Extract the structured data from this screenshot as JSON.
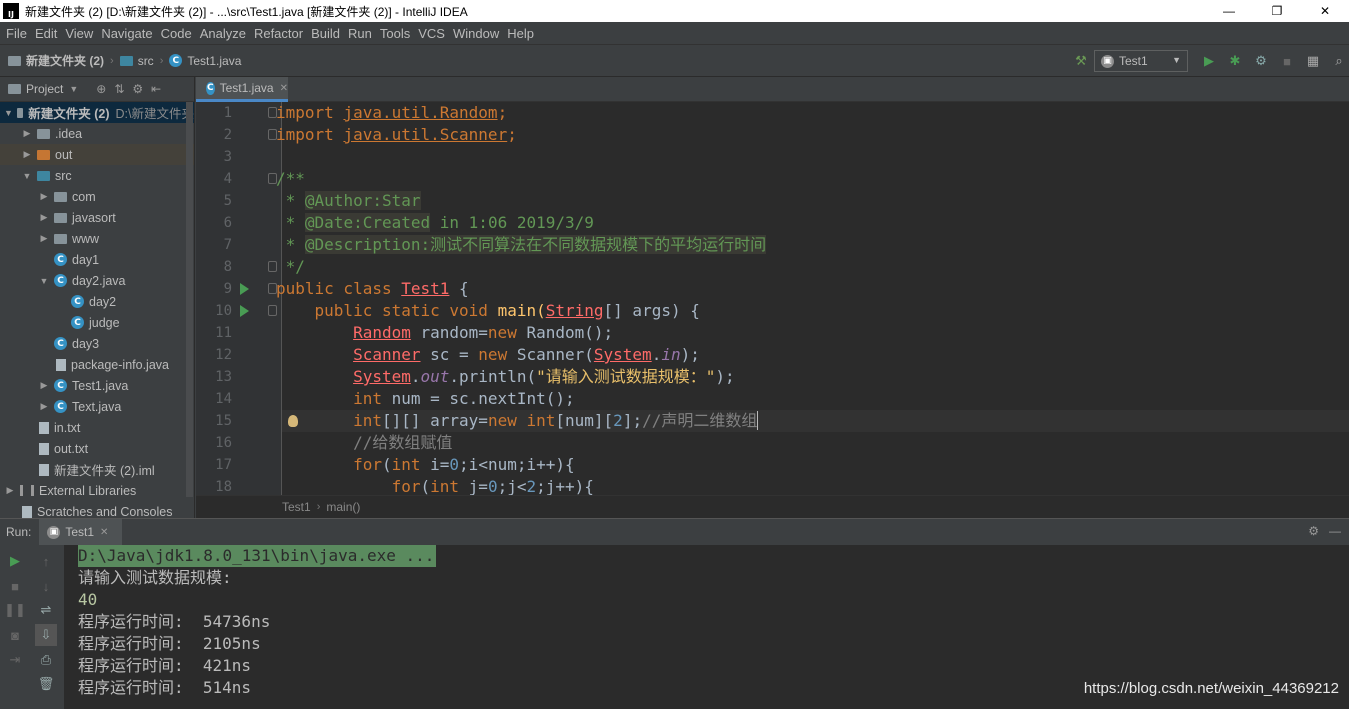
{
  "window": {
    "title": "新建文件夹 (2) [D:\\新建文件夹 (2)] - ...\\src\\Test1.java [新建文件夹 (2)] - IntelliJ IDEA",
    "logo_text": "IJ",
    "controls": [
      "—",
      "❐",
      "✕"
    ]
  },
  "menu": [
    "File",
    "Edit",
    "View",
    "Navigate",
    "Code",
    "Analyze",
    "Refactor",
    "Build",
    "Run",
    "Tools",
    "VCS",
    "Window",
    "Help"
  ],
  "navbar": {
    "project": "新建文件夹 (2)",
    "src": "src",
    "file": "Test1.java",
    "run_config": "Test1"
  },
  "project_panel": {
    "title": "Project",
    "tree": [
      {
        "label": "新建文件夹 (2)",
        "extra": "D:\\新建文件夹",
        "icon": "folder",
        "caret": "▼",
        "depth": 0
      },
      {
        "label": ".idea",
        "icon": "folder",
        "caret": "▶",
        "depth": 1
      },
      {
        "label": "out",
        "icon": "folder-orange",
        "caret": "▶",
        "depth": 1
      },
      {
        "label": "src",
        "icon": "folder-blue",
        "caret": "▼",
        "depth": 1
      },
      {
        "label": "com",
        "icon": "package",
        "caret": "▶",
        "depth": 2
      },
      {
        "label": "javasort",
        "icon": "package",
        "caret": "▶",
        "depth": 2
      },
      {
        "label": "www",
        "icon": "package",
        "caret": "▶",
        "depth": 2
      },
      {
        "label": "day1",
        "icon": "class",
        "caret": "",
        "depth": 2
      },
      {
        "label": "day2.java",
        "icon": "class",
        "caret": "▼",
        "depth": 2
      },
      {
        "label": "day2",
        "icon": "class",
        "caret": "",
        "depth": 3
      },
      {
        "label": "judge",
        "icon": "class",
        "caret": "",
        "depth": 3
      },
      {
        "label": "day3",
        "icon": "class",
        "caret": "",
        "depth": 2
      },
      {
        "label": "package-info.java",
        "icon": "file",
        "caret": "",
        "depth": 2
      },
      {
        "label": "Test1.java",
        "icon": "class",
        "caret": "▶",
        "depth": 2
      },
      {
        "label": "Text.java",
        "icon": "class",
        "caret": "▶",
        "depth": 2
      },
      {
        "label": "in.txt",
        "icon": "file",
        "caret": "",
        "depth": 1
      },
      {
        "label": "out.txt",
        "icon": "file",
        "caret": "",
        "depth": 1
      },
      {
        "label": "新建文件夹 (2).iml",
        "icon": "file",
        "caret": "",
        "depth": 1
      },
      {
        "label": "External Libraries",
        "icon": "library",
        "caret": "▶",
        "depth": 0
      },
      {
        "label": "Scratches and Consoles",
        "icon": "file",
        "caret": "",
        "depth": 0
      }
    ]
  },
  "editor": {
    "tab": "Test1.java",
    "line_numbers": [
      "1",
      "2",
      "3",
      "4",
      "5",
      "6",
      "7",
      "8",
      "9",
      "10",
      "11",
      "12",
      "13",
      "14",
      "15",
      "16",
      "17",
      "18"
    ],
    "breadcrumb": [
      "Test1",
      "main()"
    ]
  },
  "code": {
    "l1": [
      "import ",
      "java.util.Random",
      ";"
    ],
    "l2": [
      "import ",
      "java.util.Scanner",
      ";"
    ],
    "l4": "/**",
    "l5": [
      " * ",
      "@Author:Star"
    ],
    "l6": [
      " * ",
      "@Date:Created",
      " in 1:06 2019/3/9"
    ],
    "l7": [
      " * ",
      "@Description:测试不同算法在不同数据规模下的平均运行时间"
    ],
    "l8": " */",
    "l9": [
      "public class ",
      "Test1",
      " {"
    ],
    "l10": [
      "    public static void ",
      "main(",
      "String",
      "[] args) {"
    ],
    "l11": [
      "        ",
      "Random",
      " random=",
      "new ",
      "Random();"
    ],
    "l12": [
      "        ",
      "Scanner",
      " sc = ",
      "new ",
      "Scanner(",
      "System",
      ".",
      "in",
      ");"
    ],
    "l13": [
      "        ",
      "System",
      ".",
      "out",
      ".println(",
      "\"请输入测试数据规模：\"",
      ");"
    ],
    "l14": [
      "        ",
      "int ",
      "num = sc.nextInt();"
    ],
    "l15": [
      "        ",
      "int",
      "[][] array=",
      "new ",
      "int",
      "[num][",
      "2",
      "];",
      "//声明二维数组"
    ],
    "l16": [
      "        ",
      "//给数组赋值"
    ],
    "l17": [
      "        ",
      "for",
      "(",
      "int ",
      "i=",
      "0",
      ";i<num;i++){"
    ],
    "l18": [
      "            ",
      "for",
      "(",
      "int ",
      "j=",
      "0",
      ";j<",
      "2",
      ";j++){"
    ]
  },
  "run": {
    "label": "Run:",
    "tab": "Test1",
    "console": [
      "D:\\Java\\jdk1.8.0_131\\bin\\java.exe ...",
      "请输入测试数据规模:",
      "40",
      "程序运行时间:  54736ns",
      "程序运行时间:  2105ns",
      "程序运行时间:  421ns",
      "程序运行时间:  514ns"
    ]
  },
  "watermark": "https://blog.csdn.net/weixin_44369212",
  "colors": {
    "keyword": "#cc7832",
    "string": "#6a8759",
    "doc": "#629755",
    "comment": "#808080",
    "number": "#6897bb",
    "static": "#9876aa",
    "run_green": "#499c54"
  }
}
